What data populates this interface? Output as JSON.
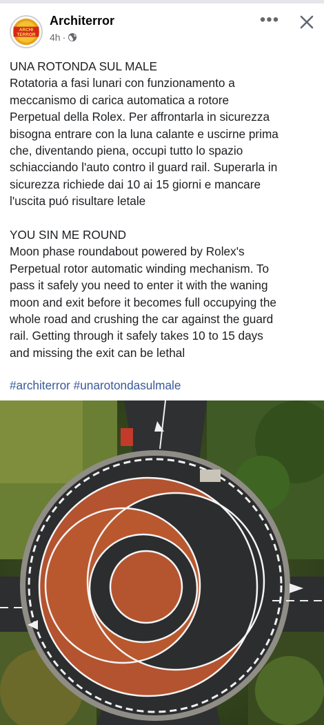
{
  "post": {
    "author": "Architerror",
    "time": "4h",
    "avatar_text_1": "ARCHI",
    "avatar_text_2": "TERROR",
    "more_icon": "more-horizontal-icon",
    "close_icon": "close-icon",
    "privacy_icon": "globe-icon",
    "text_lines": [
      "UNA ROTONDA SUL MALE",
      "Rotatoria a fasi lunari con funzionamento a",
      "meccanismo di carica automatica a rotore",
      "Perpetual della Rolex. Per affrontarla in sicurezza",
      "bisogna entrare con la luna calante e uscirne prima",
      "che, diventando piena, occupi tutto lo spazio",
      "schiacciando l'auto contro il guard rail. Superarla in",
      "sicurezza richiede dai 10 ai 15 giorni e mancare",
      "l'uscita puó risultare letale",
      "",
      "YOU SIN ME ROUND",
      "Moon phase roundabout powered by Rolex's",
      "Perpetual rotor automatic winding mechanism. To",
      "pass it safely you need to enter it with the waning",
      "moon and exit before it becomes full occupying the",
      "whole road and crushing the car against the guard",
      "rail.  Getting through it safely takes 10 to 15 days",
      "and missing the exit can be lethal"
    ],
    "hashtags": [
      "#architerror",
      "#unarotondasulmale"
    ],
    "link_color": "#385898"
  }
}
